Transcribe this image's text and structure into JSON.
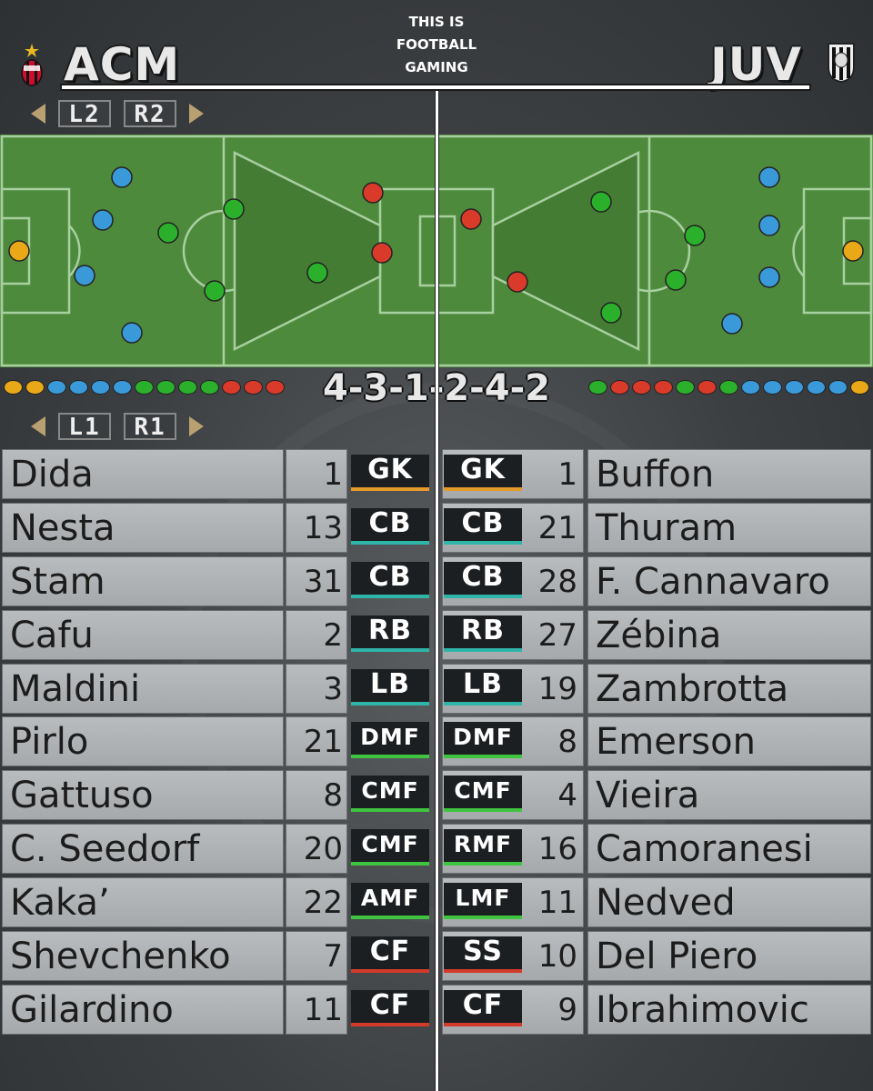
{
  "brand": {
    "line1": "THIS IS",
    "line2": "FOOTBALL",
    "line3": "GAMING"
  },
  "home": {
    "abbr": "ACM",
    "crest": "ac-milan-crest-icon"
  },
  "away": {
    "abbr": "JUV",
    "crest": "juventus-crest-icon"
  },
  "buttons": {
    "l2": "L2",
    "r2": "R2",
    "l1": "L1",
    "r1": "R1"
  },
  "formation_label": "4-3-1-2-4-2",
  "colors": {
    "gk": "#e8a818",
    "defender": "#3a9ad9",
    "midfielder": "#2bb02b",
    "forward": "#d93a2a"
  },
  "home_dots": [
    "gk",
    "gk",
    "def",
    "def",
    "def",
    "def",
    "mid",
    "mid",
    "mid",
    "mid",
    "fwd",
    "fwd",
    "fwd"
  ],
  "away_dots": [
    "mid",
    "fwd",
    "fwd",
    "fwd",
    "mid",
    "fwd",
    "mid",
    "def",
    "def",
    "def",
    "def",
    "def",
    "gk"
  ],
  "home_players": [
    {
      "name": "Dida",
      "num": "1",
      "pos": "GK",
      "role": "gk"
    },
    {
      "name": "Nesta",
      "num": "13",
      "pos": "CB",
      "role": "def"
    },
    {
      "name": "Stam",
      "num": "31",
      "pos": "CB",
      "role": "def"
    },
    {
      "name": "Cafu",
      "num": "2",
      "pos": "RB",
      "role": "def"
    },
    {
      "name": "Maldini",
      "num": "3",
      "pos": "LB",
      "role": "def"
    },
    {
      "name": "Pirlo",
      "num": "21",
      "pos": "DMF",
      "role": "mid"
    },
    {
      "name": "Gattuso",
      "num": "8",
      "pos": "CMF",
      "role": "mid"
    },
    {
      "name": "C. Seedorf",
      "num": "20",
      "pos": "CMF",
      "role": "mid"
    },
    {
      "name": "Kaka’",
      "num": "22",
      "pos": "AMF",
      "role": "mid"
    },
    {
      "name": "Shevchenko",
      "num": "7",
      "pos": "CF",
      "role": "fwd"
    },
    {
      "name": "Gilardino",
      "num": "11",
      "pos": "CF",
      "role": "fwd"
    }
  ],
  "away_players": [
    {
      "name": "Buffon",
      "num": "1",
      "pos": "GK",
      "role": "gk"
    },
    {
      "name": "Thuram",
      "num": "21",
      "pos": "CB",
      "role": "def"
    },
    {
      "name": "F. Cannavaro",
      "num": "28",
      "pos": "CB",
      "role": "def"
    },
    {
      "name": "Zébina",
      "num": "27",
      "pos": "RB",
      "role": "def"
    },
    {
      "name": "Zambrotta",
      "num": "19",
      "pos": "LB",
      "role": "def"
    },
    {
      "name": "Emerson",
      "num": "8",
      "pos": "DMF",
      "role": "mid"
    },
    {
      "name": "Vieira",
      "num": "4",
      "pos": "CMF",
      "role": "mid"
    },
    {
      "name": "Camoranesi",
      "num": "16",
      "pos": "RMF",
      "role": "mid"
    },
    {
      "name": "Nedved",
      "num": "11",
      "pos": "LMF",
      "role": "mid"
    },
    {
      "name": "Del Piero",
      "num": "10",
      "pos": "SS",
      "role": "fwd"
    },
    {
      "name": "Ibrahimovic",
      "num": "9",
      "pos": "CF",
      "role": "fwd"
    }
  ]
}
